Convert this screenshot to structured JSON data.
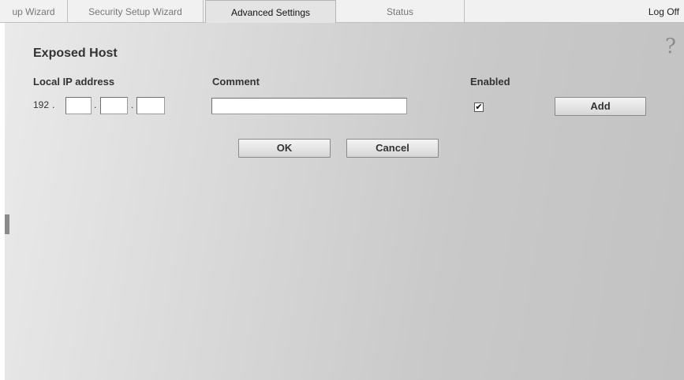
{
  "tabs": [
    {
      "label": "up Wizard"
    },
    {
      "label": "Security Setup Wizard"
    },
    {
      "label": "Advanced Settings",
      "active": true
    },
    {
      "label": "Status"
    }
  ],
  "header": {
    "logoff_label": "Log Off"
  },
  "help": {
    "glyph": "?"
  },
  "section": {
    "title": "Exposed Host"
  },
  "columns": {
    "ip_label": "Local IP address",
    "comment_label": "Comment",
    "enabled_label": "Enabled"
  },
  "ip": {
    "prefix": "192",
    "separator": ".",
    "octet2": "",
    "octet3": "",
    "octet4": ""
  },
  "comment": {
    "value": ""
  },
  "enabled": {
    "checked": true,
    "mark": "✔"
  },
  "buttons": {
    "add": "Add",
    "ok": "OK",
    "cancel": "Cancel"
  }
}
